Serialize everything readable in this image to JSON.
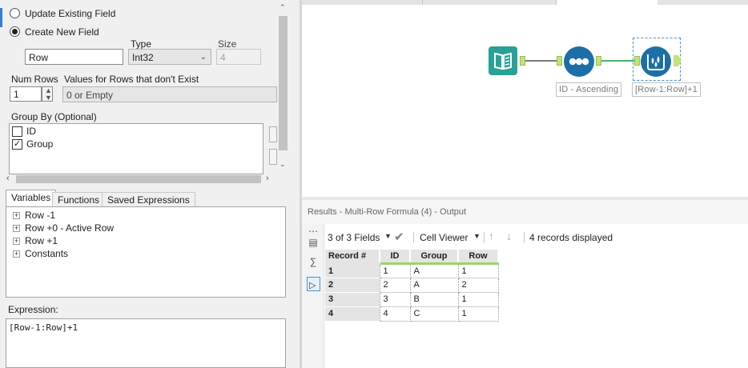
{
  "config": {
    "radio_update": "Update Existing Field",
    "radio_create": "Create New  Field",
    "type_label": "Type",
    "size_label": "Size",
    "field_name": "Row",
    "type_value": "Int32",
    "size_value": "4",
    "num_rows_label": "Num Rows",
    "num_rows_value": "1",
    "values_label": "Values for Rows that don't Exist",
    "values_value": "0 or Empty",
    "group_by_label": "Group By (Optional)",
    "group_by_items": [
      {
        "label": "ID",
        "checked": false
      },
      {
        "label": "Group",
        "checked": true
      }
    ]
  },
  "tabs": [
    "Variables",
    "Functions",
    "Saved Expressions"
  ],
  "variables_tree": [
    "Row -1",
    "Row +0 - Active Row",
    "Row +1",
    "Constants"
  ],
  "expression_label": "Expression:",
  "expression_value": "[Row-1:Row]+1",
  "canvas": {
    "sort_label": "ID - Ascending",
    "formula_label": "[Row-1:Row]+1",
    "colors": {
      "input_tool": "#2aa198",
      "sort_tool": "#1c6fa6",
      "multirow_tool": "#1c6fa6",
      "connection": "#46b46e"
    }
  },
  "results": {
    "title": "Results - Multi-Row Formula (4) - Output",
    "fields": "3 of 3 Fields",
    "viewer": "Cell Viewer",
    "records": "4 records displayed",
    "columns": [
      "Record #",
      "ID",
      "Group",
      "Row"
    ],
    "rows": [
      [
        "1",
        "1",
        "A",
        "1"
      ],
      [
        "2",
        "2",
        "A",
        "2"
      ],
      [
        "3",
        "3",
        "B",
        "1"
      ],
      [
        "4",
        "4",
        "C",
        "1"
      ]
    ]
  }
}
